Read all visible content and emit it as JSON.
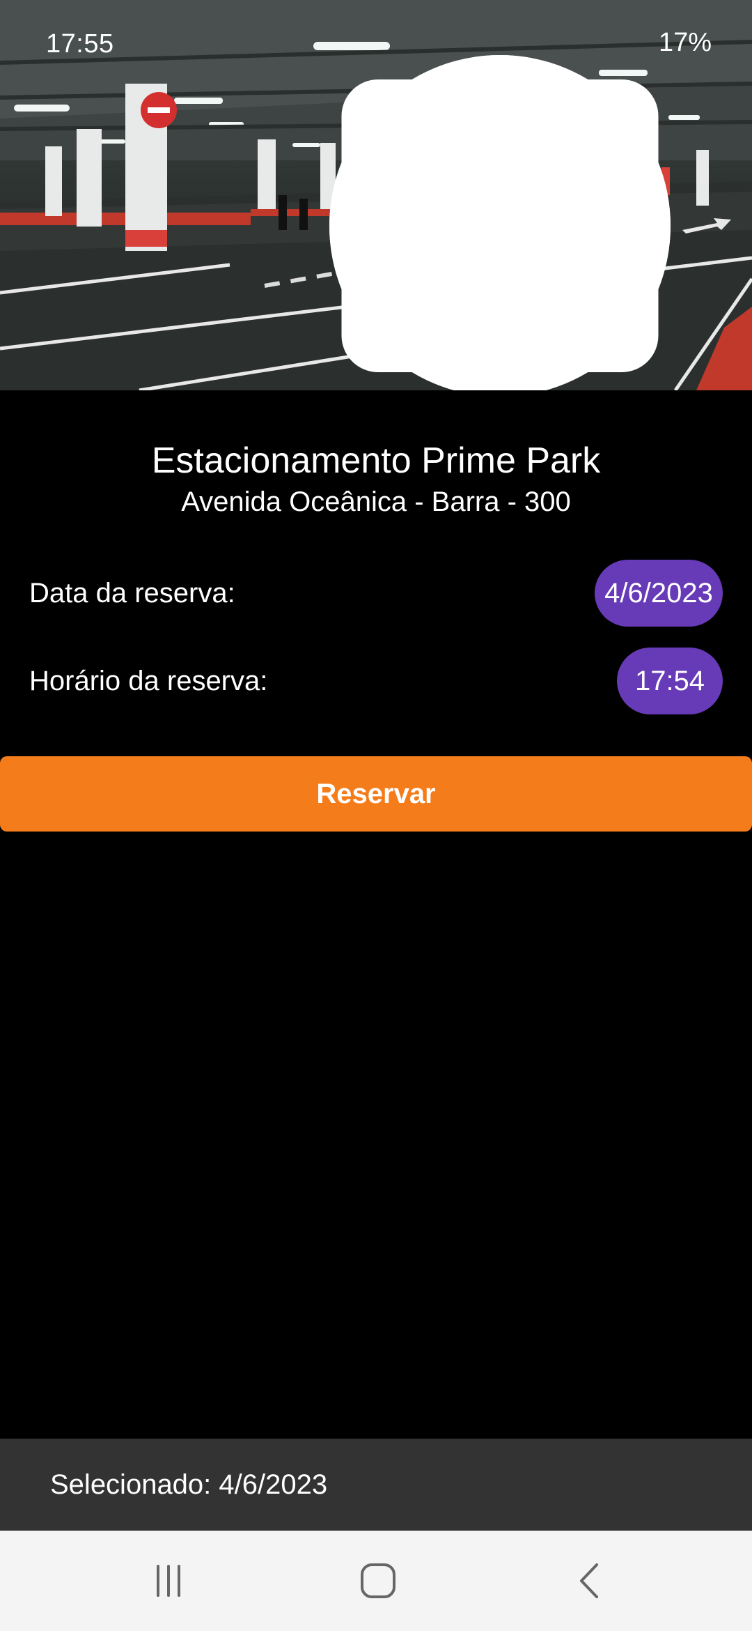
{
  "status_bar": {
    "time": "17:55",
    "battery": "17%",
    "left_icons": [
      "image-icon",
      "soccer-ball-icon",
      "soccer-ball-icon",
      "dot-icon"
    ],
    "right_icons": [
      "muted-icon",
      "wifi-icon",
      "signal-icon",
      "battery-charging-icon"
    ]
  },
  "hero": {
    "image": "parking-garage-photo"
  },
  "parking": {
    "name": "Estacionamento Prime Park",
    "address": "Avenida Oceânica - Barra - 300"
  },
  "reservation": {
    "date_label": "Data da reserva:",
    "date_value": "4/6/2023",
    "time_label": "Horário da reserva:",
    "time_value": "17:54"
  },
  "actions": {
    "reserve_label": "Reservar"
  },
  "snackbar": {
    "text": "Selecionado: 4/6/2023"
  },
  "colors": {
    "accent_purple": "#673ab7",
    "button_orange": "#f57c1a",
    "snackbar_bg": "#333333"
  },
  "nav": {
    "icons": [
      "recents-icon",
      "home-icon",
      "back-icon"
    ]
  }
}
